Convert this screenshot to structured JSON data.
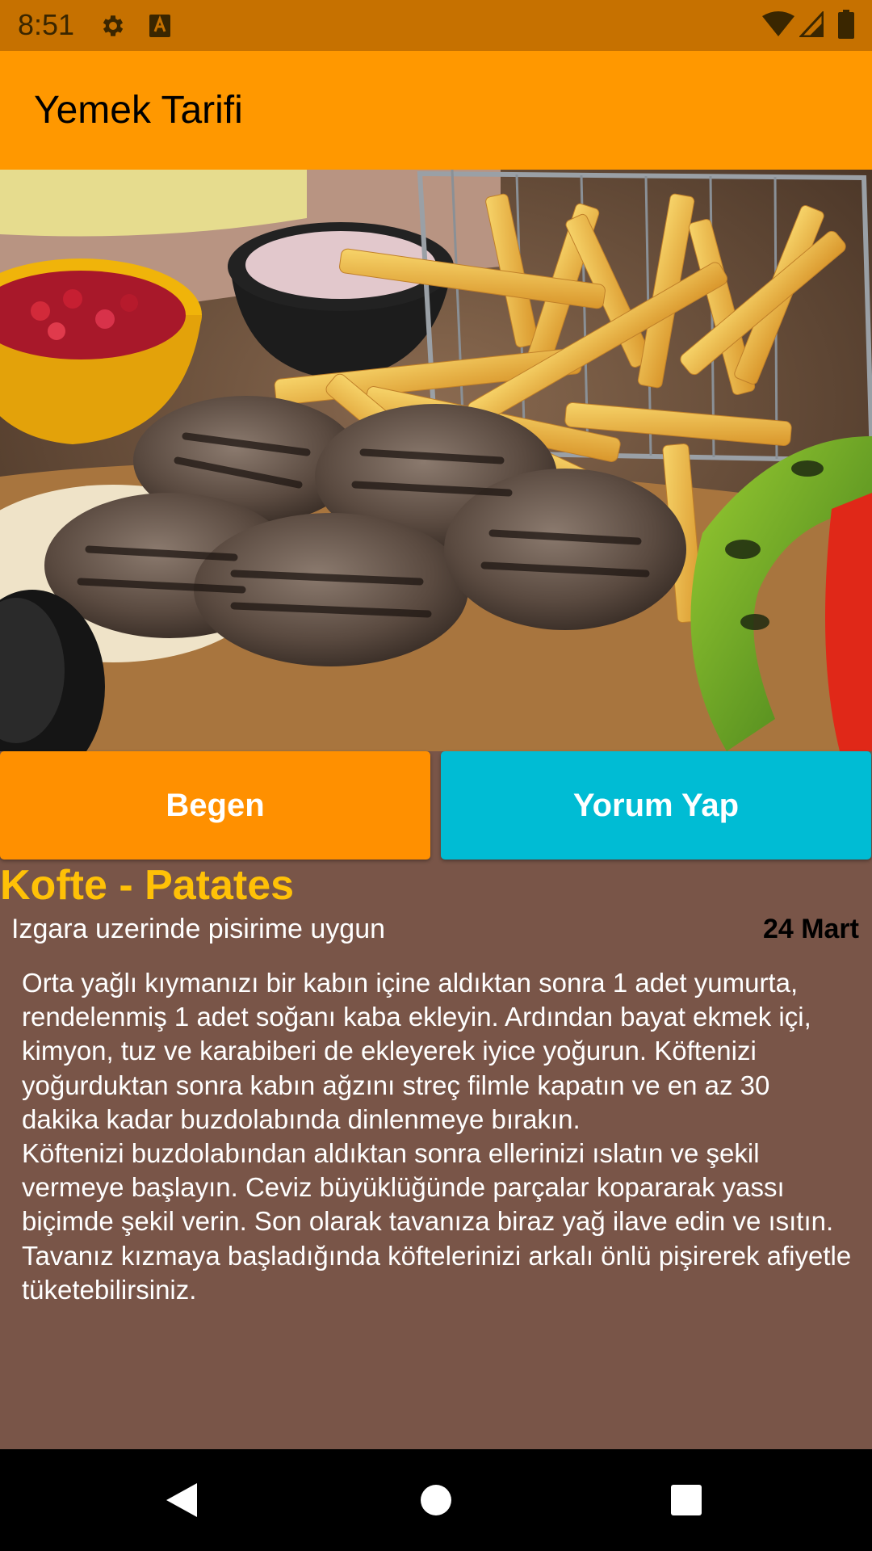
{
  "status_bar": {
    "time": "8:51",
    "icons": [
      "gear-icon",
      "a-letter-icon",
      "wifi-icon",
      "signal-icon",
      "battery-icon"
    ],
    "background": "#C67100"
  },
  "app_bar": {
    "title": "Yemek Tarifi",
    "background": "#FF9800"
  },
  "image": {
    "subject": "kofte-patates-photo"
  },
  "buttons": {
    "like_label": "Begen",
    "comment_label": "Yorum Yap",
    "like_color": "#FF9000",
    "comment_color": "#00BCD4"
  },
  "recipe": {
    "title": "Kofte - Patates",
    "subtitle": "Izgara uzerinde pisirime uygun",
    "date": "24 Mart",
    "body": "Orta yağlı kıymanızı bir kabın içine aldıktan sonra 1 adet yumurta, rendelenmiş 1 adet soğanı kaba ekleyin. Ardından bayat ekmek içi, kimyon, tuz ve karabiberi de ekleyerek iyice yoğurun. Köftenizi yoğurduktan sonra kabın ağzını streç filmle kapatın ve en az 30 dakika kadar buzdolabında dinlenmeye bırakın.\nKöftenizi buzdolabından aldıktan sonra ellerinizi ıslatın ve şekil vermeye başlayın. Ceviz büyüklüğünde parçalar kopararak yassı biçimde şekil verin. Son olarak tavanıza biraz yağ ilave edin ve ısıtın. Tavanız kızmaya başladığında köftelerinizi arkalı önlü pişirerek afiyetle tüketebilirsiniz.",
    "title_color": "#FFC107",
    "background": "#795548"
  },
  "nav_bar": {
    "icons": [
      "back-icon",
      "home-icon",
      "recents-icon"
    ]
  }
}
